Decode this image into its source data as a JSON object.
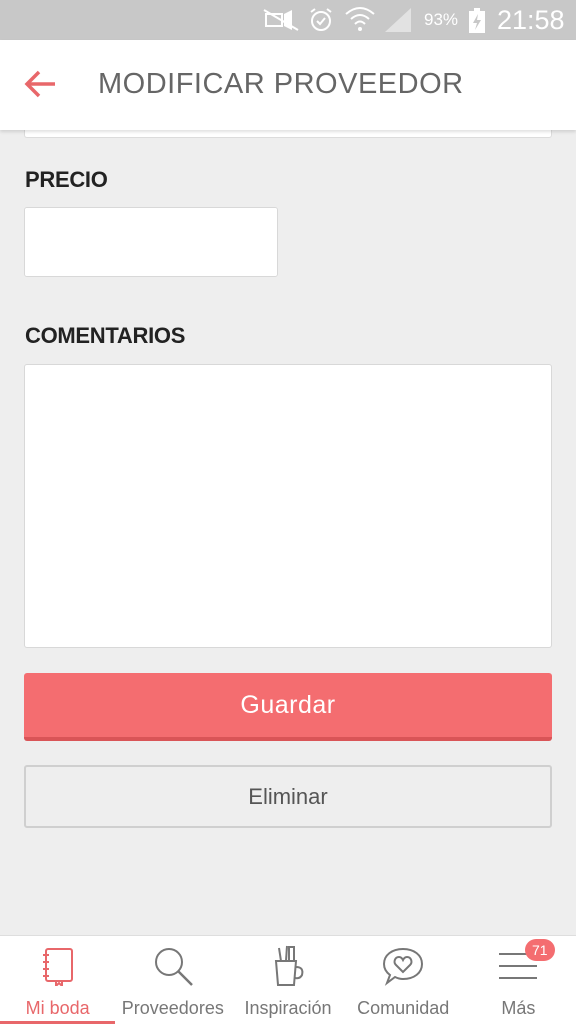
{
  "status_bar": {
    "battery_percent": "93%",
    "time": "21:58",
    "icons": [
      "mute-icon",
      "alarm-icon",
      "wifi-icon",
      "signal-icon",
      "battery-charging-icon"
    ]
  },
  "app_bar": {
    "back_icon": "arrow-left-icon",
    "title": "MODIFICAR PROVEEDOR"
  },
  "form": {
    "price_label": "PRECIO",
    "price_value": "",
    "currency_symbol": "$",
    "comments_label": "COMENTARIOS",
    "comments_value": ""
  },
  "actions": {
    "save_label": "Guardar",
    "delete_label": "Eliminar"
  },
  "bottom_nav": {
    "items": [
      {
        "label": "Mi boda",
        "icon": "notebook-icon",
        "active": true
      },
      {
        "label": "Proveedores",
        "icon": "search-icon",
        "active": false
      },
      {
        "label": "Inspiración",
        "icon": "pencil-cup-icon",
        "active": false
      },
      {
        "label": "Comunidad",
        "icon": "chat-heart-icon",
        "active": false
      },
      {
        "label": "Más",
        "icon": "menu-icon",
        "active": false,
        "badge": "71"
      }
    ]
  },
  "colors": {
    "accent": "#f46d70",
    "accent_dark": "#d95457",
    "background": "#eeeeee",
    "status_bar": "#c8c8c8"
  }
}
